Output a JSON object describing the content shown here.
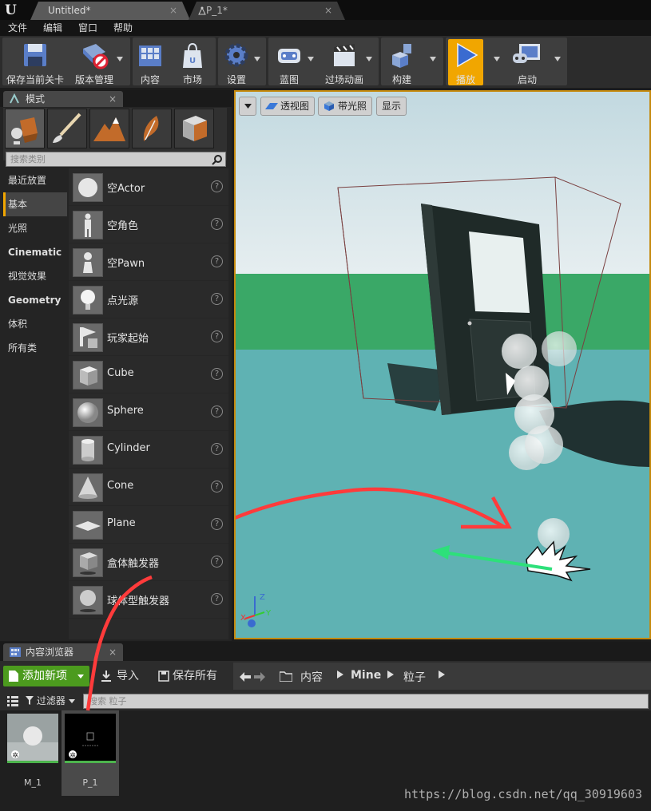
{
  "titlebar": {
    "tabs": [
      {
        "label": "Untitled*"
      },
      {
        "label": "P_1*"
      }
    ],
    "close": "×"
  },
  "menu": [
    "文件",
    "编辑",
    "窗口",
    "帮助"
  ],
  "toolbar": {
    "buttons": [
      "保存当前关卡",
      "版本管理",
      "内容",
      "市场",
      "设置",
      "蓝图",
      "过场动画",
      "构建",
      "播放",
      "启动"
    ]
  },
  "modes": {
    "title": "模式",
    "close": "×",
    "search_placeholder": "搜索类别",
    "categories": [
      "最近放置",
      "基本",
      "光照",
      "Cinematic",
      "视觉效果",
      "Geometry",
      "体积",
      "所有类"
    ],
    "actors": [
      "空Actor",
      "空角色",
      "空Pawn",
      "点光源",
      "玩家起始",
      "Cube",
      "Sphere",
      "Cylinder",
      "Cone",
      "Plane",
      "盒体触发器",
      "球体型触发器"
    ],
    "help": "?"
  },
  "viewport": {
    "buttons": [
      "透视图",
      "带光照",
      "显示"
    ]
  },
  "content_browser": {
    "title": "内容浏览器",
    "close": "×",
    "add_new": "添加新项",
    "import": "导入",
    "save_all": "保存所有",
    "breadcrumb": [
      "内容",
      "Mine",
      "粒子"
    ],
    "filter": "过滤器",
    "search_placeholder": "搜索 粒子",
    "assets": [
      "M_1",
      "P_1"
    ]
  },
  "watermark": "https://blog.csdn.net/qq_30919603",
  "colors": {
    "accent": "#f1a600",
    "add_new": "#4c9b1e",
    "annotation_arrow": "#ff3b3b"
  }
}
